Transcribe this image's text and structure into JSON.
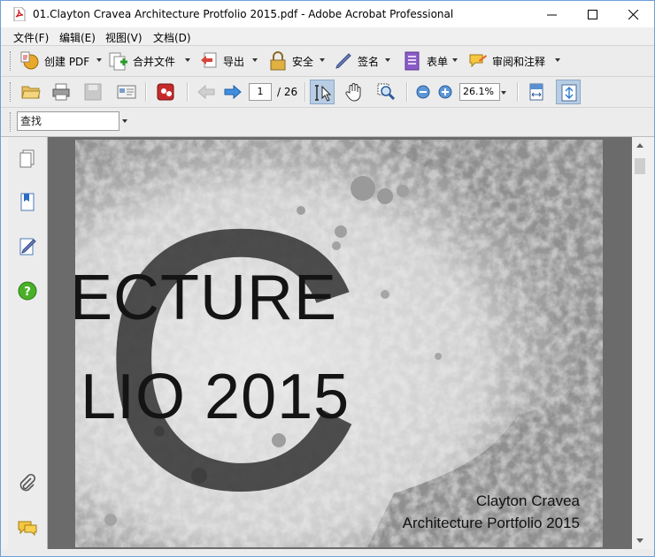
{
  "window": {
    "title": "01.Clayton Cravea Architecture Protfolio 2015.pdf - Adobe Acrobat Professional",
    "app_icon": "pdf-file-icon"
  },
  "menubar": [
    "文件(F)",
    "编辑(E)",
    "视图(V)",
    "文档(D)"
  ],
  "toolbar_tasks": [
    {
      "label": "创建 PDF",
      "icon": "create-pdf-icon"
    },
    {
      "label": "合并文件",
      "icon": "combine-files-icon"
    },
    {
      "label": "导出",
      "icon": "export-icon"
    },
    {
      "label": "安全",
      "icon": "lock-icon"
    },
    {
      "label": "签名",
      "icon": "pen-icon"
    },
    {
      "label": "表单",
      "icon": "form-icon"
    },
    {
      "label": "审阅和注释",
      "icon": "review-comment-icon"
    }
  ],
  "navigation": {
    "current_page": "1",
    "total_pages": "/ 26",
    "zoom": "26.1%"
  },
  "find": {
    "placeholder": "查找"
  },
  "document": {
    "cover_letter": "C",
    "line1": "ECTURE",
    "line2": "LIO 2015",
    "author": "Clayton Cravea",
    "subtitle": "Architecture Portfolio 2015"
  },
  "colors": {
    "accent": "#6f9fd6",
    "page_bg": "#8f8f8f",
    "doc_area": "#6b6b6b"
  }
}
